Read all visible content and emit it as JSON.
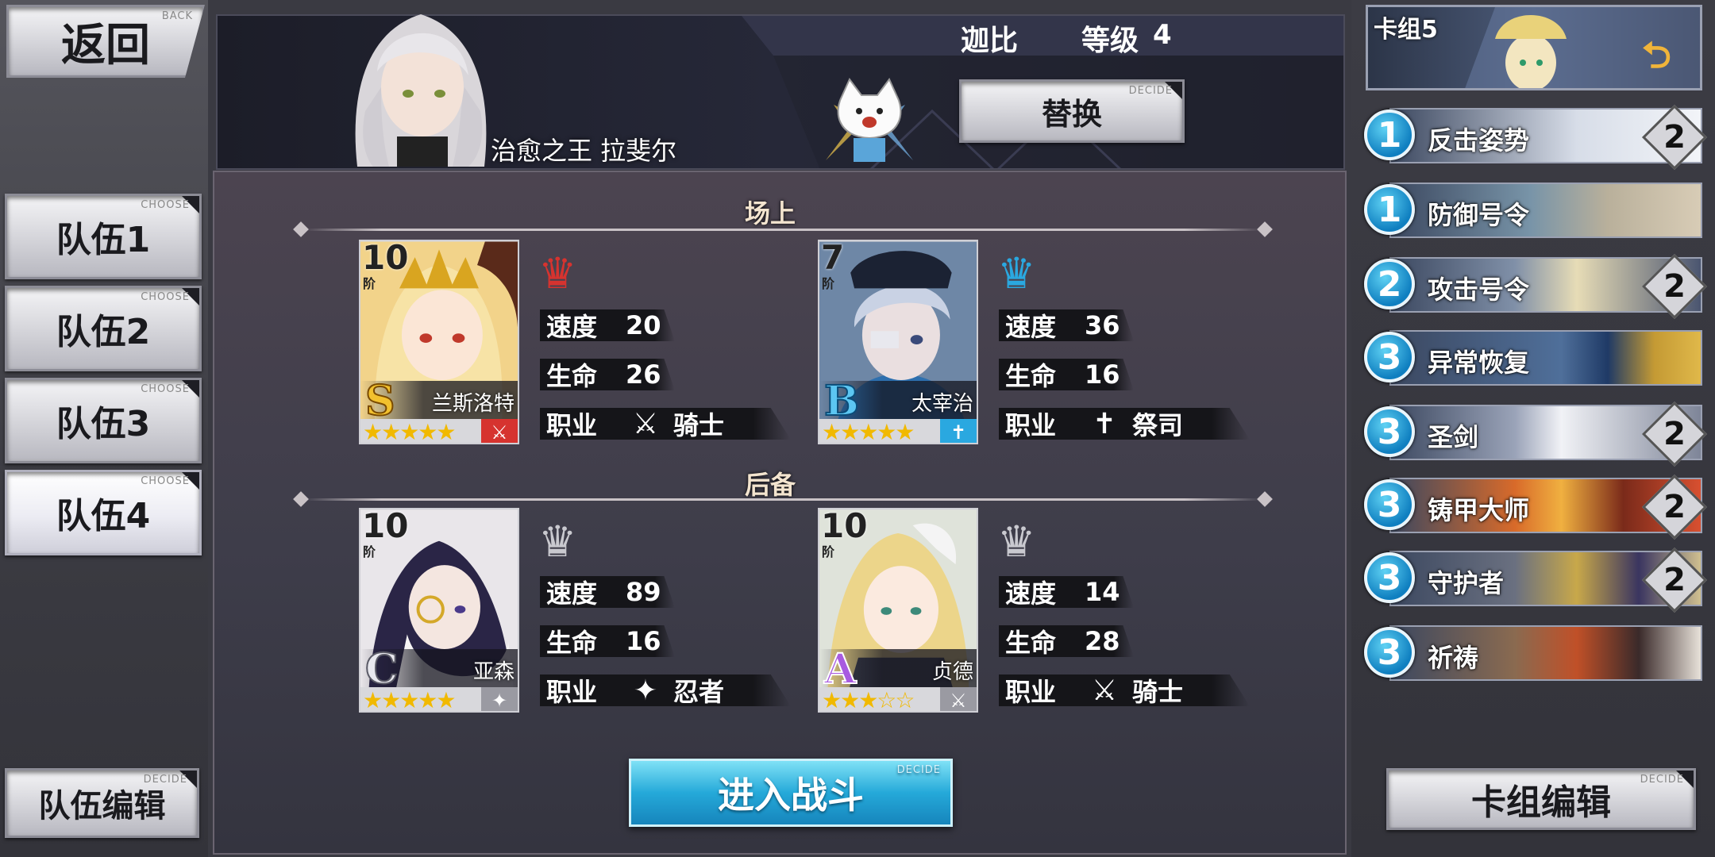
{
  "left_panel": {
    "back": {
      "label": "返回",
      "sub": "BACK"
    },
    "teams": [
      {
        "label": "队伍1",
        "sub": "CHOOSE",
        "active": false
      },
      {
        "label": "队伍2",
        "sub": "CHOOSE",
        "active": false
      },
      {
        "label": "队伍3",
        "sub": "CHOOSE",
        "active": false
      },
      {
        "label": "队伍4",
        "sub": "CHOOSE",
        "active": true
      }
    ],
    "edit": {
      "label": "队伍编辑",
      "sub": "DECIDE"
    }
  },
  "banner": {
    "player_name": "迦比",
    "level_label": "等级",
    "level_value": "4",
    "hero_title": "治愈之王 拉斐尔",
    "replace": {
      "label": "替换",
      "sub": "DECIDE"
    }
  },
  "center": {
    "field_title": "场上",
    "reserve_title": "后备",
    "stat_labels": {
      "speed": "速度",
      "hp": "生命",
      "class": "职业"
    },
    "rank_suffix": "阶",
    "field_units": [
      {
        "name": "兰斯洛特",
        "rank": "10",
        "grade": "S",
        "stars": "★★★★★",
        "speed": "20",
        "hp": "26",
        "class": "骑士",
        "class_icon": "sword-shield-icon",
        "crown_color": "#d6332f"
      },
      {
        "name": "太宰治",
        "rank": "7",
        "grade": "B",
        "stars": "★★★★★",
        "speed": "36",
        "hp": "16",
        "class": "祭司",
        "class_icon": "cross-icon",
        "crown_color": "#2aa8e0"
      }
    ],
    "reserve_units": [
      {
        "name": "亚森",
        "rank": "10",
        "grade": "C",
        "stars": "★★★★★",
        "speed": "89",
        "hp": "16",
        "class": "忍者",
        "class_icon": "shuriken-icon",
        "crown_color": "#c9c9cf"
      },
      {
        "name": "贞德",
        "rank": "10",
        "grade": "A",
        "stars": "★★★☆☆",
        "speed": "14",
        "hp": "28",
        "class": "骑士",
        "class_icon": "sword-shield-icon",
        "crown_color": "#c9c9cf"
      }
    ],
    "battle": {
      "label": "进入战斗",
      "sub": "DECIDE"
    }
  },
  "right_panel": {
    "deck_name": "卡组5",
    "skills": [
      {
        "cost": "1",
        "name": "反击姿势",
        "count": "2"
      },
      {
        "cost": "1",
        "name": "防御号令",
        "count": ""
      },
      {
        "cost": "2",
        "name": "攻击号令",
        "count": "2"
      },
      {
        "cost": "3",
        "name": "异常恢复",
        "count": ""
      },
      {
        "cost": "3",
        "name": "圣剑",
        "count": "2"
      },
      {
        "cost": "3",
        "name": "铸甲大师",
        "count": "2"
      },
      {
        "cost": "3",
        "name": "守护者",
        "count": "2"
      },
      {
        "cost": "3",
        "name": "祈祷",
        "count": ""
      }
    ],
    "edit": {
      "label": "卡组编辑",
      "sub": "DECIDE"
    }
  },
  "colors": {
    "accent_blue": "#25a9d9",
    "cost_blue": "#0f7fc0",
    "star_gold": "#f1b900"
  }
}
